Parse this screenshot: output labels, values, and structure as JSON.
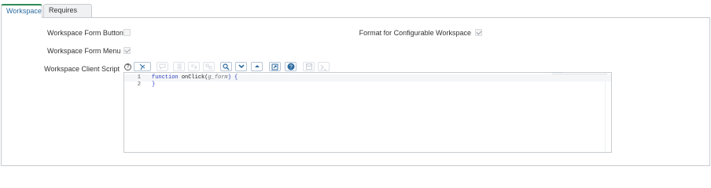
{
  "tabs": [
    {
      "label": "Workspace",
      "active": true
    },
    {
      "label": "Requires role",
      "active": false
    }
  ],
  "fields": {
    "workspace_form_button": {
      "label": "Workspace Form Button",
      "checked": false
    },
    "format_for_configurable_workspace": {
      "label": "Format for Configurable Workspace",
      "checked": true
    },
    "workspace_form_menu": {
      "label": "Workspace Form Menu",
      "checked": true
    },
    "workspace_client_script": {
      "label": "Workspace Client Script"
    }
  },
  "editor": {
    "lines": [
      {
        "number": "1",
        "keyword": "function",
        "name": "onClick",
        "open_paren": "(",
        "arg": "g_form",
        "close": ") {"
      },
      {
        "number": "2",
        "text": "}"
      }
    ]
  },
  "toolbar_icons": [
    "script-debugger-icon",
    "comment-icon",
    "format-code-icon",
    "replace-icon",
    "replace-all-icon",
    "search-icon",
    "find-next-icon",
    "find-previous-icon",
    "fullscreen-icon",
    "help-icon",
    "save-icon",
    "toggle-syntax-icon"
  ],
  "colors": {
    "accent_tab": "#2e8a55",
    "toolbar_blue": "#2d6ca0",
    "keyword": "#2b3dbf"
  }
}
